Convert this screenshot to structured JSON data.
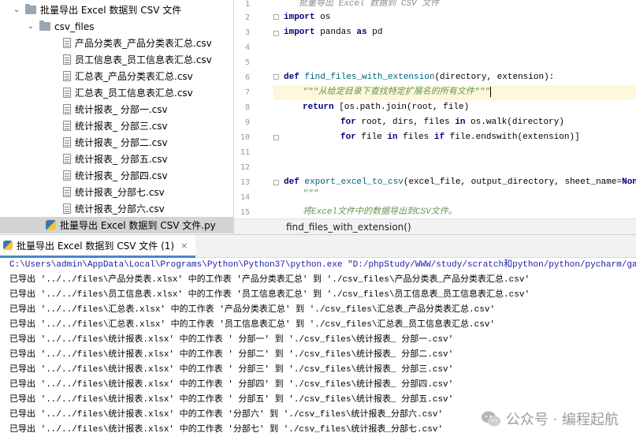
{
  "tree": {
    "items": [
      {
        "label": "批量导出 Excel 数据到 CSV 文件",
        "type": "folder",
        "expanded": true,
        "depth": 0
      },
      {
        "label": "csv_files",
        "type": "folder",
        "expanded": true,
        "depth": 1
      },
      {
        "label": "产品分类表_产品分类表汇总.csv",
        "type": "file",
        "depth": 2
      },
      {
        "label": "员工信息表_员工信息表汇总.csv",
        "type": "file",
        "depth": 2
      },
      {
        "label": "汇总表_产品分类表汇总.csv",
        "type": "file",
        "depth": 2
      },
      {
        "label": "汇总表_员工信息表汇总.csv",
        "type": "file",
        "depth": 2
      },
      {
        "label": "统计报表_ 分部一.csv",
        "type": "file",
        "depth": 2
      },
      {
        "label": "统计报表_ 分部三.csv",
        "type": "file",
        "depth": 2
      },
      {
        "label": "统计报表_ 分部二.csv",
        "type": "file",
        "depth": 2
      },
      {
        "label": "统计报表_ 分部五.csv",
        "type": "file",
        "depth": 2
      },
      {
        "label": "统计报表_ 分部四.csv",
        "type": "file",
        "depth": 2
      },
      {
        "label": "统计报表_分部七.csv",
        "type": "file",
        "depth": 2
      },
      {
        "label": "统计报表_分部六.csv",
        "type": "file",
        "depth": 2
      },
      {
        "label": "批量导出 Excel 数据到 CSV 文件.py",
        "type": "python",
        "depth": 1,
        "selected": true
      }
    ]
  },
  "editor": {
    "line_numbers": [
      "1",
      "2",
      "3",
      "4",
      "5",
      "6",
      "7",
      "8",
      "9",
      "10",
      "11",
      "12",
      "13",
      "14",
      "15"
    ],
    "lines": {
      "l1": "批量导出 Excel 数据到 CSV 文件",
      "l2_kw": "import",
      "l2_rest": " os",
      "l3_kw": "import",
      "l3_mid": " pandas ",
      "l3_kw2": "as",
      "l3_rest": " pd",
      "l6_kw": "def",
      "l6_fn": " find_files_with_extension",
      "l6_rest": "(directory, extension):",
      "l7_doc": "\"\"\"从给定目录下查找特定扩展名的所有文件\"\"\"",
      "l8_kw": "return",
      "l8_rest": " [os.path.join(root, file)",
      "l9_kw": "for",
      "l9_mid": " root, dirs, files ",
      "l9_kw2": "in",
      "l9_rest": " os.walk(directory)",
      "l10_kw": "for",
      "l10_mid": " file ",
      "l10_kw2": "in",
      "l10_mid2": " files ",
      "l10_kw3": "if",
      "l10_rest": " file.endswith(extension)]",
      "l13_kw": "def",
      "l13_fn": " export_excel_to_csv",
      "l13_rest": "(excel_file, output_directory, sheet_name=",
      "l13_none": "None",
      "l13_end": "):",
      "l14": "\"\"\"",
      "l15": "将Excel文件中的数据导出到CSV文件。"
    },
    "breadcrumb": "find_files_with_extension()"
  },
  "run": {
    "tab_label": "批量导出 Excel 数据到 CSV 文件 (1)",
    "close_symbol": "×",
    "command": "C:\\Users\\admin\\AppData\\Local\\Programs\\Python\\Python37\\python.exe \"D:/phpStudy/WWW/study/scratch和python/python/pycharm/gameDemos/file",
    "output": [
      "已导出 '../../files\\产品分类表.xlsx' 中的工作表 '产品分类表汇总' 到 './csv_files\\产品分类表_产品分类表汇总.csv'",
      "已导出 '../../files\\员工信息表.xlsx' 中的工作表 '员工信息表汇总' 到 './csv_files\\员工信息表_员工信息表汇总.csv'",
      "已导出 '../../files\\汇总表.xlsx' 中的工作表 '产品分类表汇总' 到 './csv_files\\汇总表_产品分类表汇总.csv'",
      "已导出 '../../files\\汇总表.xlsx' 中的工作表 '员工信息表汇总' 到 './csv_files\\汇总表_员工信息表汇总.csv'",
      "已导出 '../../files\\统计报表.xlsx' 中的工作表 ' 分部一' 到 './csv_files\\统计报表_ 分部一.csv'",
      "已导出 '../../files\\统计报表.xlsx' 中的工作表 ' 分部二' 到 './csv_files\\统计报表_ 分部二.csv'",
      "已导出 '../../files\\统计报表.xlsx' 中的工作表 ' 分部三' 到 './csv_files\\统计报表_ 分部三.csv'",
      "已导出 '../../files\\统计报表.xlsx' 中的工作表 ' 分部四' 到 './csv_files\\统计报表_ 分部四.csv'",
      "已导出 '../../files\\统计报表.xlsx' 中的工作表 ' 分部五' 到 './csv_files\\统计报表_ 分部五.csv'",
      "已导出 '../../files\\统计报表.xlsx' 中的工作表 '分部六' 到 './csv_files\\统计报表_分部六.csv'",
      "已导出 '../../files\\统计报表.xlsx' 中的工作表 '分部七' 到 './csv_files\\统计报表_分部七.csv'"
    ]
  },
  "watermark": {
    "text": "公众号 · 编程起航"
  },
  "colors": {
    "keyword": "#000080",
    "docstring": "#629755",
    "selection": "#d4d4d4",
    "current_line": "#fdf8dc",
    "command": "#1a1aa6"
  }
}
